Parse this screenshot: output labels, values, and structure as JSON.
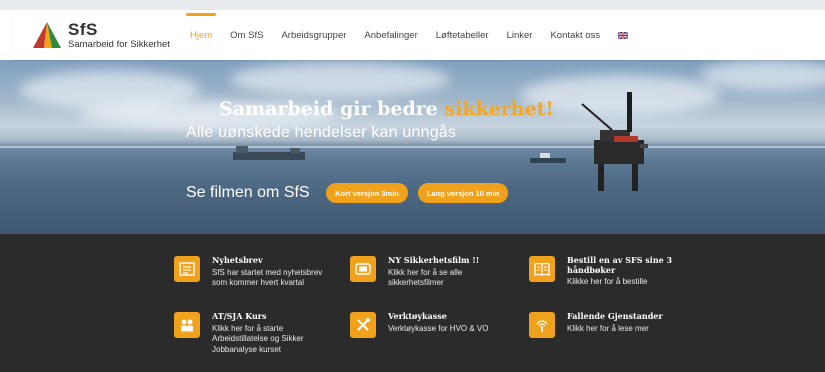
{
  "brand": {
    "name": "SfS",
    "tagline": "Samarbeid for Sikkerhet"
  },
  "nav": [
    {
      "label": "Hjem",
      "active": true
    },
    {
      "label": "Om SfS",
      "active": false
    },
    {
      "label": "Arbeidsgrupper",
      "active": false
    },
    {
      "label": "Anbefalinger",
      "active": false
    },
    {
      "label": "Løftetabeller",
      "active": false
    },
    {
      "label": "Linker",
      "active": false
    },
    {
      "label": "Kontakt oss",
      "active": false
    }
  ],
  "language_flag": "uk-flag-icon",
  "hero": {
    "title_part1": "Samarbeid gir bedre ",
    "title_highlight": "sikkerhet!",
    "subtitle": "Alle uønskede hendelser kan unngås",
    "film_label": "Se filmen om SfS",
    "btn_short": "Kort versjon 3min",
    "btn_long": "Lang versjon 10 min"
  },
  "tiles": [
    {
      "icon": "newsletter-icon",
      "title": "Nyhetsbrev",
      "desc": [
        "SfS har startet med nyhetsbrev",
        "som kommer hvert kvartal"
      ]
    },
    {
      "icon": "tv-icon",
      "title": "NY Sikkerhetsfilm !!",
      "desc": [
        "Klikk her for å se alle",
        "sikkerhetsfilmer"
      ]
    },
    {
      "icon": "book-icon",
      "title": "Bestill en av SFS sine 3 håndbøker",
      "desc": [
        "Klikke her for å bestille"
      ]
    },
    {
      "icon": "people-icon",
      "title": "AT/SJA Kurs",
      "desc": [
        "Klikk her for å starte",
        "Arbeidstillatelse og Sikker",
        "Jobbanalyse kurset"
      ]
    },
    {
      "icon": "tools-icon",
      "title": "Verktøykasse",
      "desc": [
        "Verktøykasse for HVO & VO"
      ]
    },
    {
      "icon": "alert-icon",
      "title": "Fallende Gjenstander",
      "desc": [
        "Klikk her for å lese mer"
      ]
    }
  ],
  "colors": {
    "accent": "#f0a21d",
    "dark_bg": "#2b2b2b",
    "nav_text": "#444444"
  }
}
